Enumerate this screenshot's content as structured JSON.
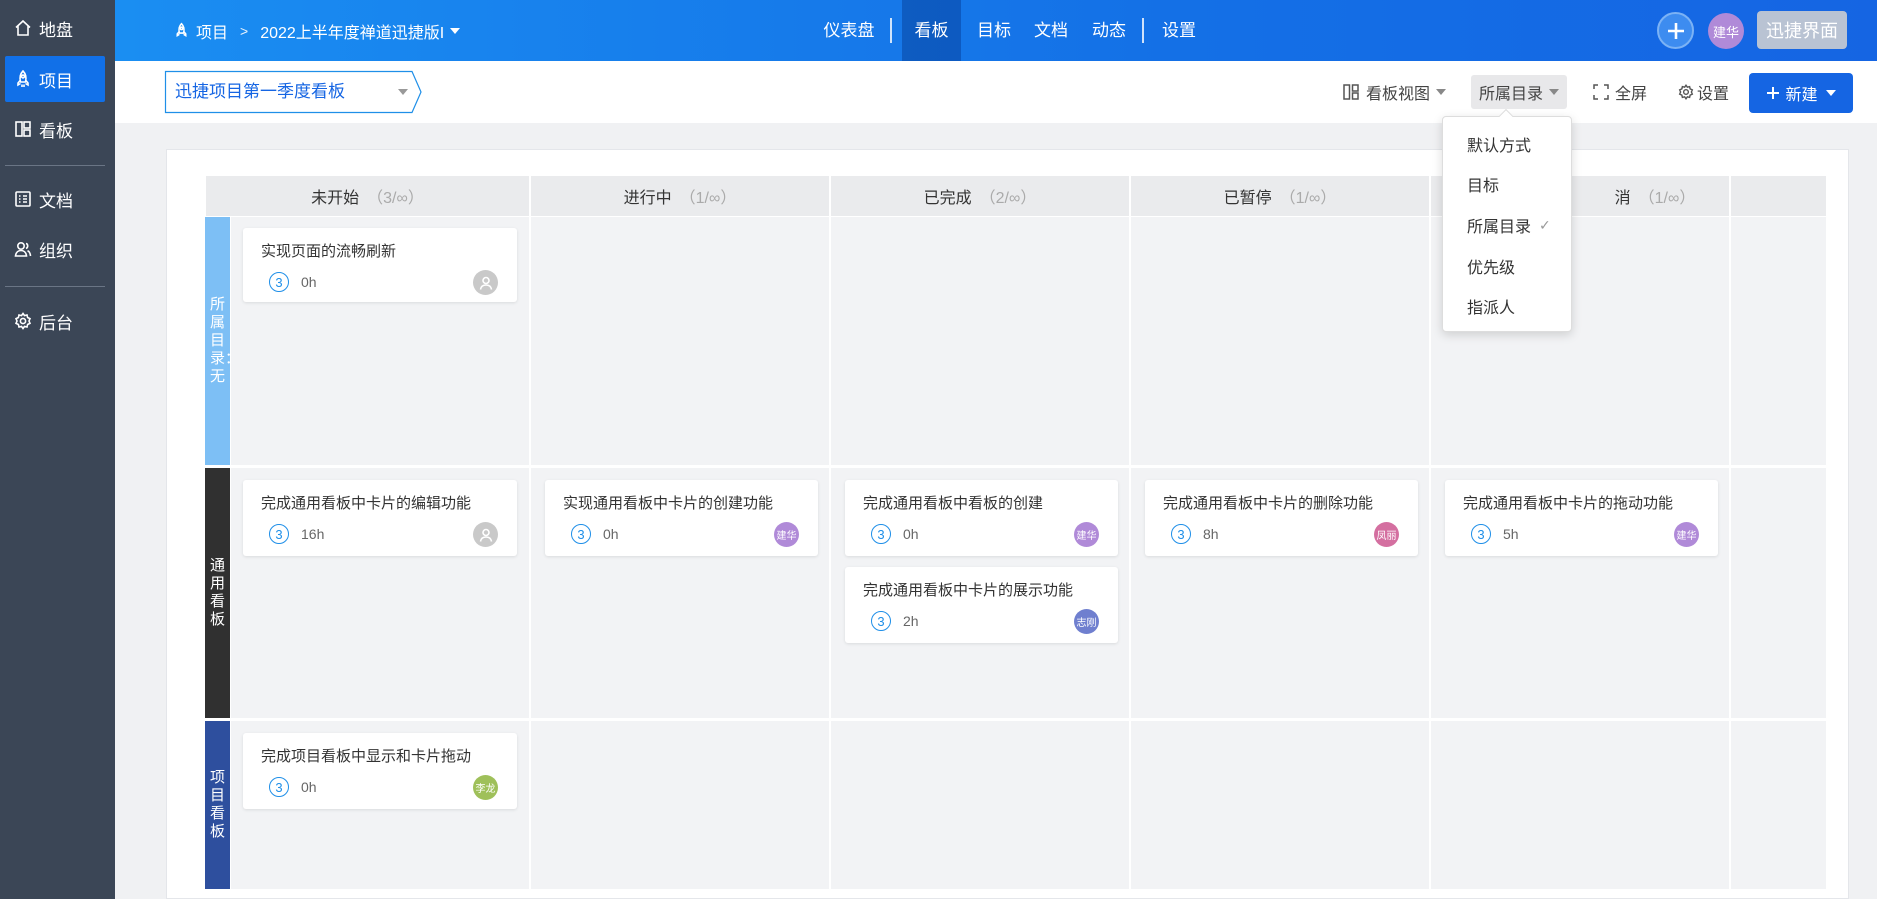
{
  "sidebar": {
    "items": [
      {
        "label": "地盘",
        "icon": "home-icon"
      },
      {
        "label": "项目",
        "icon": "rocket-icon"
      },
      {
        "label": "看板",
        "icon": "board-icon"
      },
      {
        "label": "文档",
        "icon": "doc-icon"
      },
      {
        "label": "组织",
        "icon": "people-icon"
      },
      {
        "label": "后台",
        "icon": "gear-icon"
      }
    ]
  },
  "topbar": {
    "crumb_root": "项目",
    "crumb_project": "2022上半年度禅道迅捷版I",
    "nav": [
      "仪表盘",
      "看板",
      "目标",
      "文档",
      "动态",
      "设置"
    ],
    "user_initials": "建华",
    "quick_button": "迅捷界面"
  },
  "toolbar": {
    "board_name": "迅捷项目第一季度看板",
    "view_label": "看板视图",
    "group_label": "所属目录",
    "fullscreen_label": "全屏",
    "settings_label": "设置",
    "new_label": "新建"
  },
  "columns": [
    {
      "name": "未开始",
      "count": "（3/∞）"
    },
    {
      "name": "进行中",
      "count": "（1/∞）"
    },
    {
      "name": "已完成",
      "count": "（2/∞）"
    },
    {
      "name": "已暂停",
      "count": "（1/∞）"
    },
    {
      "name": "消",
      "count": "（1/∞）"
    }
  ],
  "lanes": [
    {
      "label": "所属目录：无",
      "color": "#7dbff5"
    },
    {
      "label": "通用看板",
      "color": "#303030"
    },
    {
      "label": "项目看板",
      "color": "#2e4f9e"
    }
  ],
  "cards": [
    {
      "title": "实现页面的流畅刷新",
      "num": "3",
      "hours": "0h",
      "assignee": ""
    },
    {
      "title": "完成通用看板中卡片的编辑功能",
      "num": "3",
      "hours": "16h",
      "assignee": ""
    },
    {
      "title": "实现通用看板中卡片的创建功能",
      "num": "3",
      "hours": "0h",
      "assignee": "建华"
    },
    {
      "title": "完成通用看板中看板的创建",
      "num": "3",
      "hours": "0h",
      "assignee": "建华"
    },
    {
      "title": "完成通用看板中卡片的展示功能",
      "num": "3",
      "hours": "2h",
      "assignee": "志刚"
    },
    {
      "title": "完成通用看板中卡片的删除功能",
      "num": "3",
      "hours": "8h",
      "assignee": "凤丽"
    },
    {
      "title": "完成通用看板中卡片的拖动功能",
      "num": "3",
      "hours": "5h",
      "assignee": "建华"
    },
    {
      "title": "完成项目看板中显示和卡片拖动",
      "num": "3",
      "hours": "0h",
      "assignee": "李龙"
    }
  ],
  "dropdown": {
    "items": [
      "默认方式",
      "目标",
      "所属目录",
      "优先级",
      "指派人"
    ],
    "selected_mark": "✓"
  },
  "colors": {
    "accent": "#1565e3",
    "sidebar_bg": "#3b4656",
    "avatar_jianhua": "#b08ad8",
    "avatar_fengli": "#d46fa0",
    "avatar_zhigang": "#6f7fcf",
    "avatar_lilong": "#9fc05a"
  }
}
